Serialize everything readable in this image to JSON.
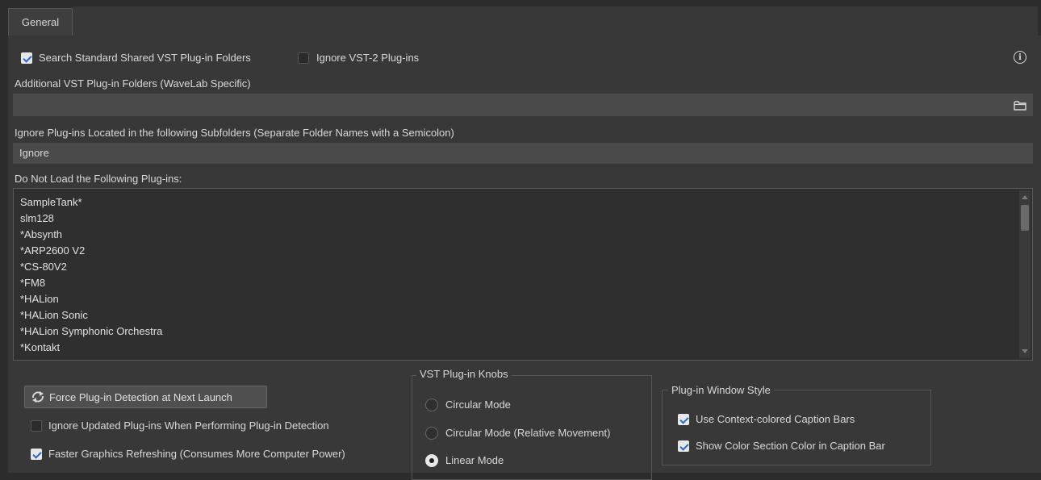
{
  "tabs": [
    {
      "label": "General"
    }
  ],
  "options": {
    "search_standard": {
      "label": "Search Standard Shared VST Plug-in Folders",
      "checked": true
    },
    "ignore_vst2": {
      "label": "Ignore VST-2 Plug-ins",
      "checked": false
    }
  },
  "additional_folders": {
    "label": "Additional VST Plug-in Folders (WaveLab Specific)",
    "value": ""
  },
  "ignore_subfolders": {
    "label": "Ignore Plug-ins Located in the following Subfolders (Separate Folder Names with a Semicolon)",
    "value": "Ignore"
  },
  "do_not_load": {
    "label": "Do Not Load the Following Plug-ins:",
    "items": [
      "SampleTank*",
      "slm128",
      "*Absynth",
      "*ARP2600 V2",
      "*CS-80V2",
      "*FM8",
      "*HALion",
      "*HALion Sonic",
      "*HALion Symphonic Orchestra",
      "*Kontakt"
    ]
  },
  "force_button": {
    "label": "Force Plug-in Detection at Next Launch",
    "icon": "refresh-icon"
  },
  "ignore_updated": {
    "label": "Ignore Updated Plug-ins When Performing Plug-in Detection",
    "checked": false
  },
  "faster_graphics": {
    "label": "Faster Graphics Refreshing (Consumes More Computer Power)",
    "checked": true
  },
  "knobs": {
    "title": "VST Plug-in Knobs",
    "options": [
      {
        "label": "Circular Mode",
        "selected": false
      },
      {
        "label": "Circular Mode (Relative Movement)",
        "selected": false
      },
      {
        "label": "Linear Mode",
        "selected": true
      }
    ]
  },
  "window_style": {
    "title": "Plug-in Window Style",
    "options": [
      {
        "label": "Use Context-colored Caption Bars",
        "checked": true
      },
      {
        "label": "Show Color Section Color in Caption Bar",
        "checked": true
      }
    ]
  },
  "icons": {
    "info": "info-icon",
    "folder": "folder-icon"
  },
  "colors": {
    "background": "#383838",
    "field": "#4a4a4a",
    "list_bg": "#2f2f2f",
    "check_mark": "#2a66c8"
  }
}
